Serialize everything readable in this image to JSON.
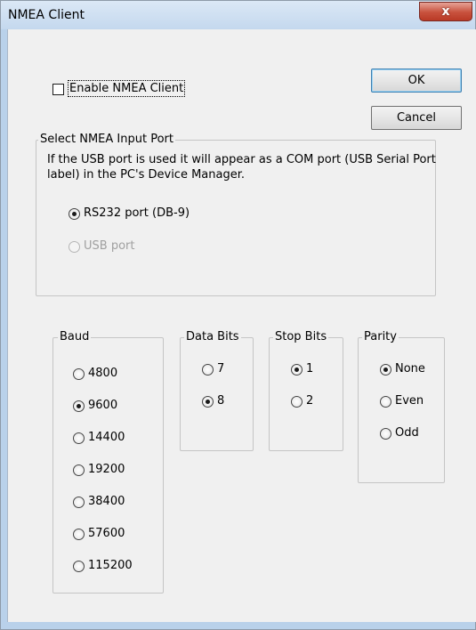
{
  "window": {
    "title": "NMEA Client",
    "close_label": "x"
  },
  "enable": {
    "label": "Enable NMEA Client",
    "checked": false
  },
  "buttons": {
    "ok": "OK",
    "cancel": "Cancel"
  },
  "input_port": {
    "label": "Select NMEA Input Port",
    "description": "If the USB port is used it will appear as a  COM port (USB Serial Port label) in the PC's Device Manager.",
    "options": [
      {
        "label": "RS232 port (DB-9)",
        "checked": true,
        "enabled": true
      },
      {
        "label": "USB port",
        "checked": false,
        "enabled": false
      }
    ]
  },
  "baud": {
    "label": "Baud",
    "options": [
      "4800",
      "9600",
      "14400",
      "19200",
      "38400",
      "57600",
      "115200"
    ],
    "selected": "9600"
  },
  "data_bits": {
    "label": "Data Bits",
    "options": [
      "7",
      "8"
    ],
    "selected": "8"
  },
  "stop_bits": {
    "label": "Stop Bits",
    "options": [
      "1",
      "2"
    ],
    "selected": "1"
  },
  "parity": {
    "label": "Parity",
    "options": [
      "None",
      "Even",
      "Odd"
    ],
    "selected": "None"
  }
}
